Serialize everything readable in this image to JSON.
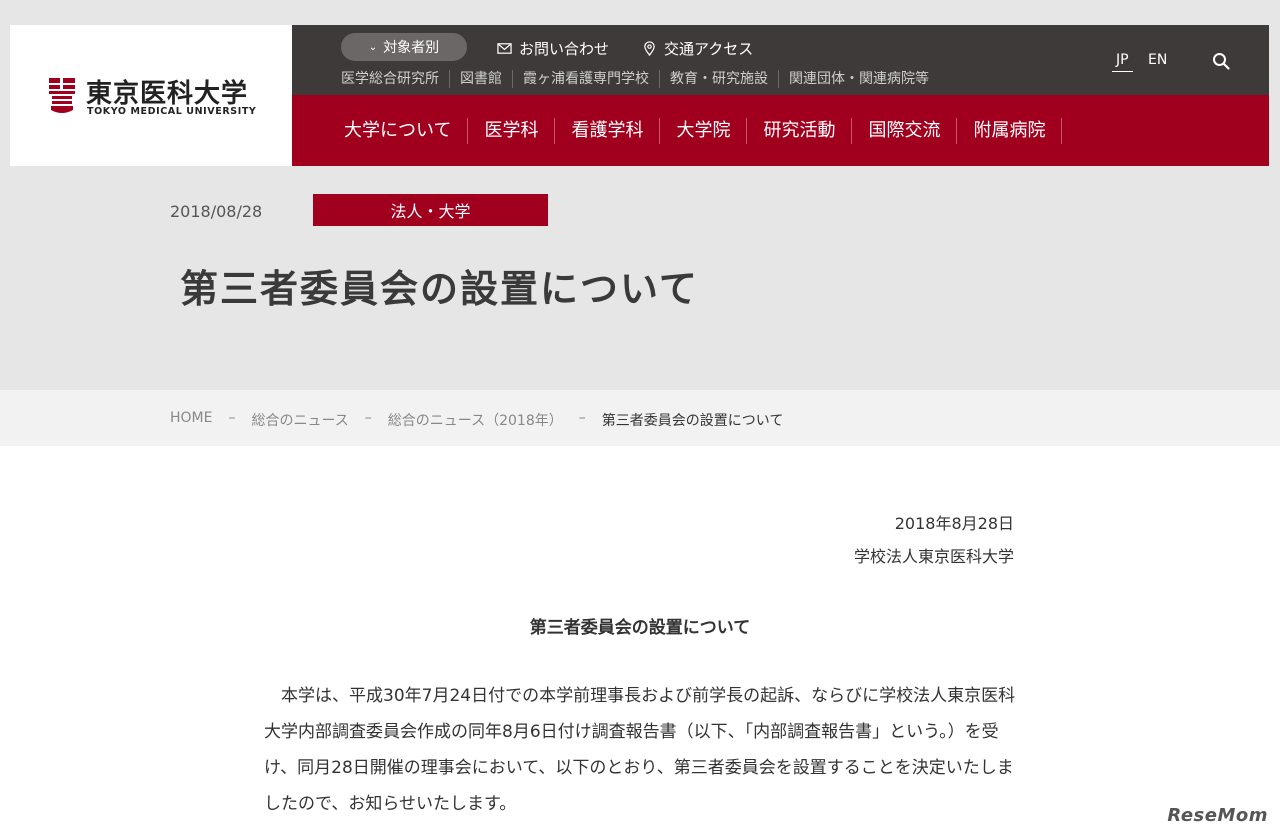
{
  "logo": {
    "name_jp": "東京医科大学",
    "name_en": "TOKYO MEDICAL UNIVERSITY"
  },
  "top_bar": {
    "audience_label": "対象者別",
    "contact_label": "お問い合わせ",
    "access_label": "交通アクセス",
    "sub_links": [
      "医学総合研究所",
      "図書館",
      "霞ヶ浦看護専門学校",
      "教育・研究施設",
      "関連団体・関連病院等"
    ],
    "lang_jp": "JP",
    "lang_en": "EN"
  },
  "main_nav": [
    "大学について",
    "医学科",
    "看護学科",
    "大学院",
    "研究活動",
    "国際交流",
    "附属病院"
  ],
  "article": {
    "date": "2018/08/28",
    "category": "法人・大学",
    "title": "第三者委員会の設置について"
  },
  "breadcrumb": {
    "items": [
      "HOME",
      "総合のニュース",
      "総合のニュース（2018年）"
    ],
    "current": "第三者委員会の設置について",
    "separator": "–"
  },
  "content": {
    "issue_date": "2018年8月28日",
    "issuer": "学校法人東京医科大学",
    "heading": "第三者委員会の設置について",
    "body": "本学は、平成30年7月24日付での本学前理事長および前学長の起訴、ならびに学校法人東京医科大学内部調査委員会作成の同年8月6日付け調査報告書（以下、「内部調査報告書」という。）を受け、同月28日開催の理事会において、以下のとおり、第三者委員会を設置することを決定いたしましたので、お知らせいたします。"
  },
  "watermark": "ReseMom",
  "colors": {
    "brand_red": "#a0001e",
    "top_bar": "#3e3a39",
    "page_bg": "#e6e6e6"
  }
}
